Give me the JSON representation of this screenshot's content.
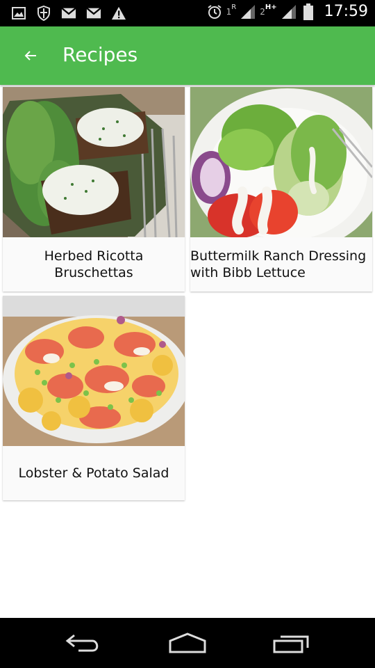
{
  "status_bar": {
    "icons_left": [
      "image-icon",
      "shield-icon",
      "gmail-icon",
      "gmail-icon",
      "warning-icon"
    ],
    "icons_right": [
      "alarm-icon",
      "signal-icon",
      "signal-icon",
      "battery-icon"
    ],
    "sim1": "1",
    "sim1_sup": "R",
    "sim2": "2",
    "sim2_sup": "H+",
    "time": "17:59"
  },
  "app_bar": {
    "title": "Recipes",
    "color": "#4fba4f"
  },
  "recipes": [
    {
      "title": "Herbed Ricotta Bruschettas"
    },
    {
      "title": "Buttermilk Ranch Dressing with Bibb Lettuce"
    },
    {
      "title": "Lobster & Potato Salad"
    }
  ],
  "nav_bar": {
    "buttons": [
      "back-icon",
      "home-icon",
      "recents-icon"
    ]
  }
}
